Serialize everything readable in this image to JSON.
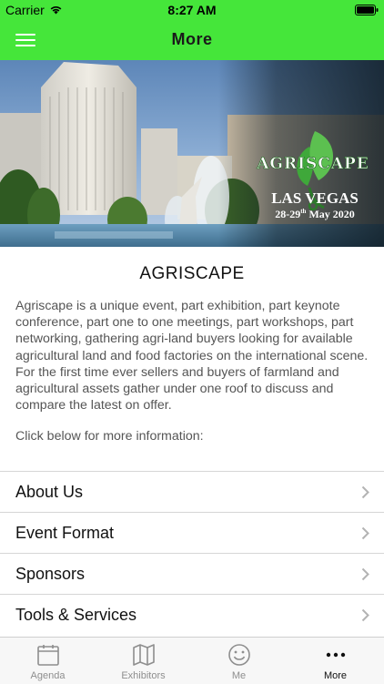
{
  "status_bar": {
    "carrier": "Carrier",
    "time": "8:27 AM"
  },
  "nav": {
    "title": "More",
    "color": "#45e63a"
  },
  "banner": {
    "logo_text": "AGRISCAPE",
    "city": "LAS VEGAS",
    "date_day": "28-29",
    "date_suffix": "th",
    "date_month": " May 2020"
  },
  "content": {
    "title": "AGRISCAPE",
    "description": "Agriscape is a unique event, part exhibition, part keynote conference, part one to one meetings, part workshops, part networking, gathering agri-land buyers looking for available agricultural land and food factories on the international scene. For the first time ever sellers and buyers of farmland and agricultural assets gather under one roof to discuss and compare the latest on offer.",
    "info": "Click below for more information:"
  },
  "menu_items": [
    {
      "label": "About Us"
    },
    {
      "label": "Event Format"
    },
    {
      "label": "Sponsors"
    },
    {
      "label": "Tools & Services"
    }
  ],
  "tabs": [
    {
      "label": "Agenda",
      "icon": "calendar-icon"
    },
    {
      "label": "Exhibitors",
      "icon": "map-icon"
    },
    {
      "label": "Me",
      "icon": "smiley-icon"
    },
    {
      "label": "More",
      "icon": "more-dots-icon",
      "active": true
    }
  ]
}
